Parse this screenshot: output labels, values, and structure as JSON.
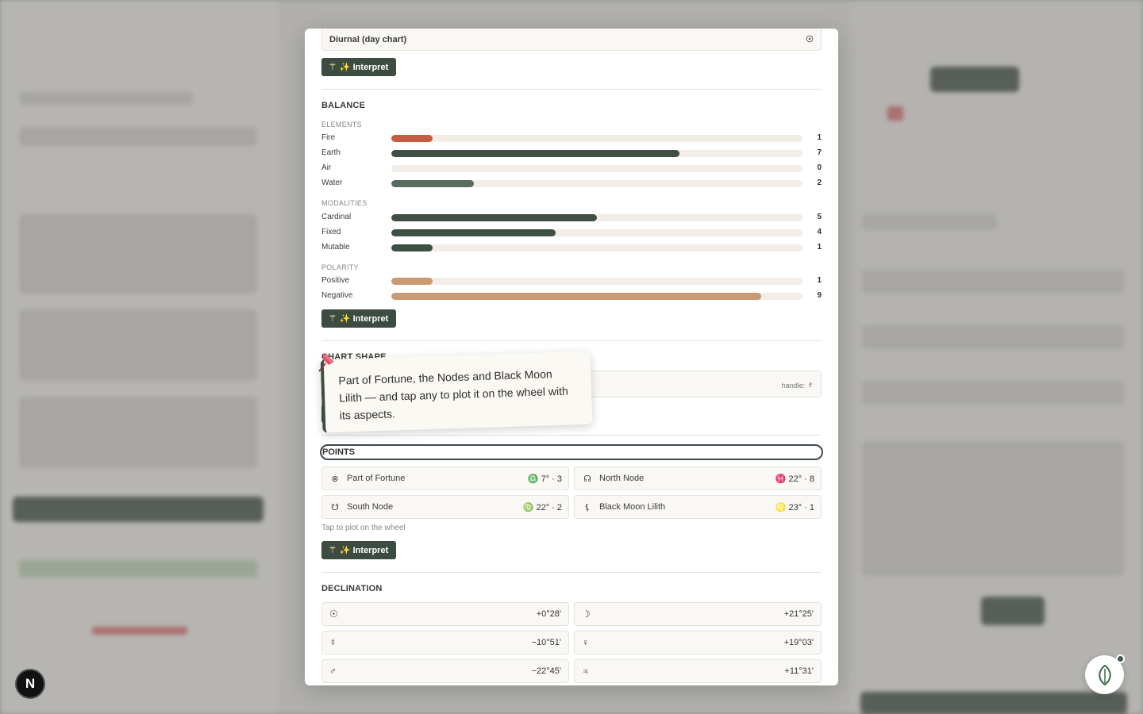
{
  "chart_select": {
    "value": "Diurnal (day chart)",
    "icon": "sun-icon"
  },
  "interpret_label": "✨ Interpret",
  "balance": {
    "title": "BALANCE",
    "elements": {
      "title": "ELEMENTS",
      "rows": [
        {
          "label": "Fire",
          "count": "1",
          "value": 1,
          "max": 10,
          "color": "#c75b43"
        },
        {
          "label": "Earth",
          "count": "7",
          "value": 7,
          "max": 10,
          "color": "#3f4f43"
        },
        {
          "label": "Air",
          "count": "0",
          "value": 0,
          "max": 10,
          "color": "#3f4f43"
        },
        {
          "label": "Water",
          "count": "2",
          "value": 2,
          "max": 10,
          "color": "#5a6b60"
        }
      ]
    },
    "modalities": {
      "title": "MODALITIES",
      "rows": [
        {
          "label": "Cardinal",
          "count": "5",
          "value": 5,
          "max": 10,
          "color": "#3f4f43"
        },
        {
          "label": "Fixed",
          "count": "4",
          "value": 4,
          "max": 10,
          "color": "#3f4f43"
        },
        {
          "label": "Mutable",
          "count": "1",
          "value": 1,
          "max": 10,
          "color": "#3f4f43"
        }
      ]
    },
    "polarity": {
      "title": "POLARITY",
      "rows": [
        {
          "label": "Positive",
          "count": "1",
          "value": 1,
          "max": 10,
          "color": "#c99a74"
        },
        {
          "label": "Negative",
          "count": "9",
          "value": 9,
          "max": 10,
          "color": "#c99a74"
        }
      ]
    }
  },
  "chart_shape": {
    "title": "CHART SHAPE",
    "handle_label": "handle:",
    "handle_glyph": "♇"
  },
  "points": {
    "title": "POINTS",
    "items": [
      {
        "icon": "⊗",
        "name": "Part of Fortune",
        "value": "♎ 7° · 3"
      },
      {
        "icon": "☊",
        "name": "North Node",
        "value": "♓ 22° · 8"
      },
      {
        "icon": "☋",
        "name": "South Node",
        "value": "♍ 22° · 2"
      },
      {
        "icon": "⚸",
        "name": "Black Moon Lilith",
        "value": "♌ 23° · 1"
      }
    ],
    "hint": "Tap to plot on the wheel"
  },
  "declination": {
    "title": "DECLINATION",
    "items": [
      {
        "icon": "☉",
        "value": "+0°28'"
      },
      {
        "icon": "☽",
        "value": "+21°25'"
      },
      {
        "icon": "☿",
        "value": "−10°51'"
      },
      {
        "icon": "♀",
        "value": "+19°03'"
      },
      {
        "icon": "♂",
        "value": "−22°45'"
      },
      {
        "icon": "♃",
        "value": "+11°31'"
      }
    ]
  },
  "tooltip": {
    "text": "Part of Fortune, the Nodes and Black Moon Lilith — and tap any to plot it on the wheel with its aspects."
  },
  "next_badge": "N",
  "colors": {
    "accent": "#3d4c40",
    "fire": "#c75b43",
    "polarity": "#c99a74",
    "track": "#f2ede6"
  }
}
